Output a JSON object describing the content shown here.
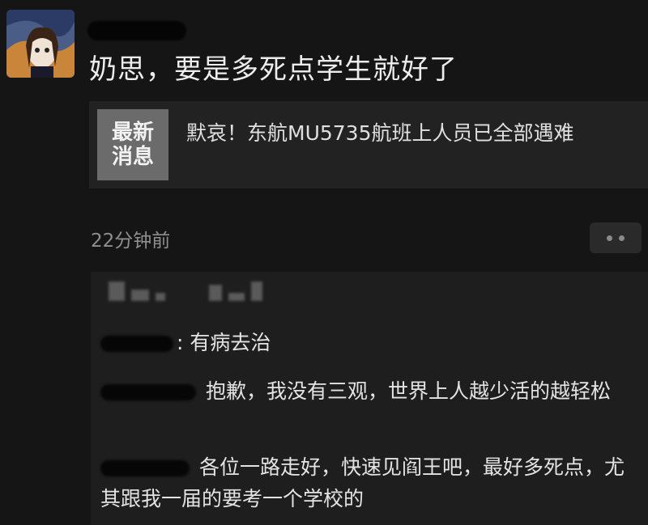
{
  "post": {
    "text": "奶思，要是多死点学生就好了"
  },
  "link_card": {
    "thumb_line1": "最新",
    "thumb_line2": "消息",
    "title": "默哀！东航MU5735航班上人员已全部遇难"
  },
  "meta": {
    "timestamp": "22分钟前"
  },
  "comments": [
    {
      "text": "有病去治"
    },
    {
      "text": "抱歉，我没有三观，世界上人越少活的越轻松"
    },
    {
      "text": "各位一路走好，快速见阎王吧，最好多死点，尤其跟我一届的要考一个学校的"
    }
  ],
  "icons": {
    "more": "more-dots-icon",
    "avatar": "anime-girl-avatar"
  }
}
